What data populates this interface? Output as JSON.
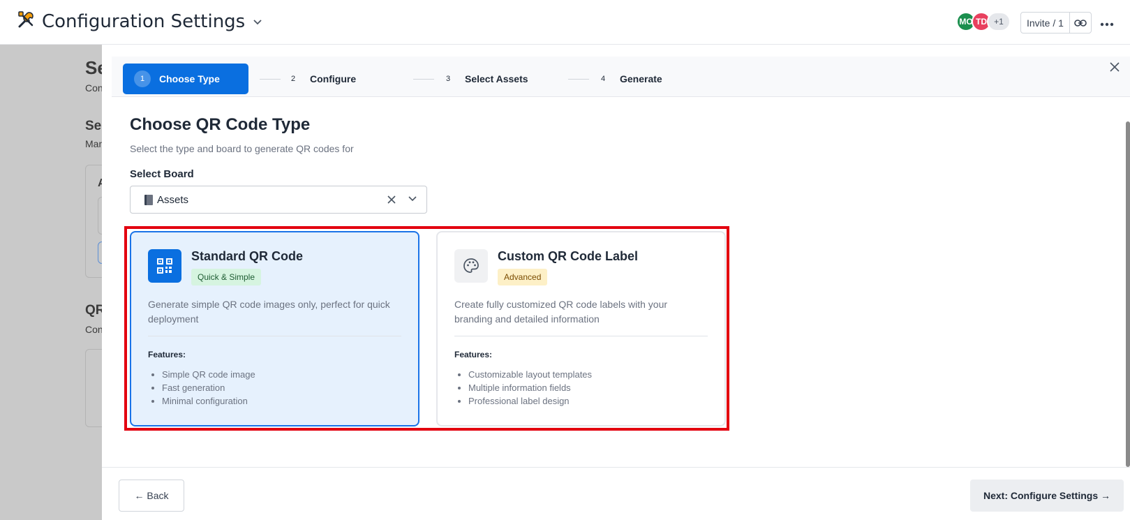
{
  "app": {
    "title": "Configuration Settings",
    "avatars": [
      {
        "initials": "MO",
        "color": "#1b8f4e"
      },
      {
        "initials": "TD",
        "color": "#e8405e"
      },
      {
        "initials": "+1",
        "color": "#e5e7eb"
      }
    ],
    "invite_label": "Invite / 1"
  },
  "background_page": {
    "fragments": [
      "Se",
      "Con",
      "Se",
      "Man",
      "A",
      "QR",
      "Con"
    ]
  },
  "stepper": {
    "steps": [
      {
        "number": "1",
        "label": "Choose Type",
        "active": true
      },
      {
        "number": "2",
        "label": "Configure",
        "active": false
      },
      {
        "number": "3",
        "label": "Select Assets",
        "active": false
      },
      {
        "number": "4",
        "label": "Generate",
        "active": false
      }
    ]
  },
  "main": {
    "heading": "Choose QR Code Type",
    "subheading": "Select the type and board to generate QR codes for",
    "board_label": "Select Board",
    "board_value": "Assets"
  },
  "cards": [
    {
      "title": "Standard QR Code",
      "badge": "Quick & Simple",
      "badge_color": "#d6f4e0",
      "description": "Generate simple QR code images only, perfect for quick deployment",
      "features_label": "Features:",
      "features": [
        "Simple QR code image",
        "Fast generation",
        "Minimal configuration"
      ],
      "selected": true,
      "icon": "qr-code-icon"
    },
    {
      "title": "Custom QR Code Label",
      "badge": "Advanced",
      "badge_color": "#fdf0c7",
      "description": "Create fully customized QR code labels with your branding and detailed information",
      "features_label": "Features:",
      "features": [
        "Customizable layout templates",
        "Multiple information fields",
        "Professional label design"
      ],
      "selected": false,
      "icon": "palette-icon"
    }
  ],
  "footer": {
    "back_label": "← Back",
    "next_label": "Next: Configure Settings →"
  },
  "colors": {
    "primary": "#0a6fe0",
    "highlight": "#e3000f",
    "overlay": "#c9c9c9"
  }
}
